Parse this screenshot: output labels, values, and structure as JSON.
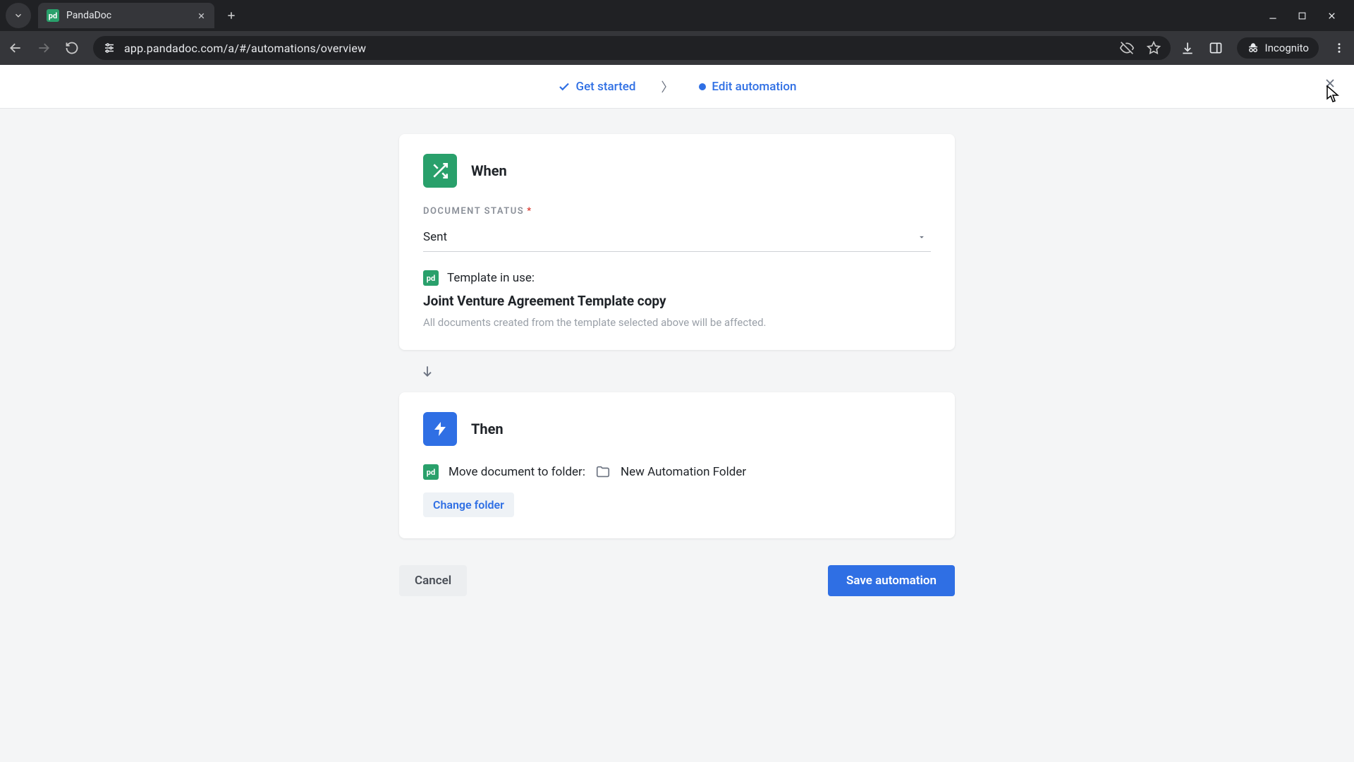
{
  "browser": {
    "tab_title": "PandaDoc",
    "url": "app.pandadoc.com/a/#/automations/overview",
    "incognito_label": "Incognito"
  },
  "stepper": {
    "step1": "Get started",
    "step2": "Edit automation"
  },
  "when": {
    "title": "When",
    "field_label": "DOCUMENT STATUS",
    "status_value": "Sent",
    "template_label": "Template in use:",
    "template_name": "Joint Venture Agreement Template copy",
    "hint": "All documents created from the template selected above will be affected."
  },
  "then": {
    "title": "Then",
    "move_label": "Move document to folder:",
    "folder_name": "New Automation Folder",
    "change_folder": "Change folder"
  },
  "footer": {
    "cancel": "Cancel",
    "save": "Save automation"
  }
}
